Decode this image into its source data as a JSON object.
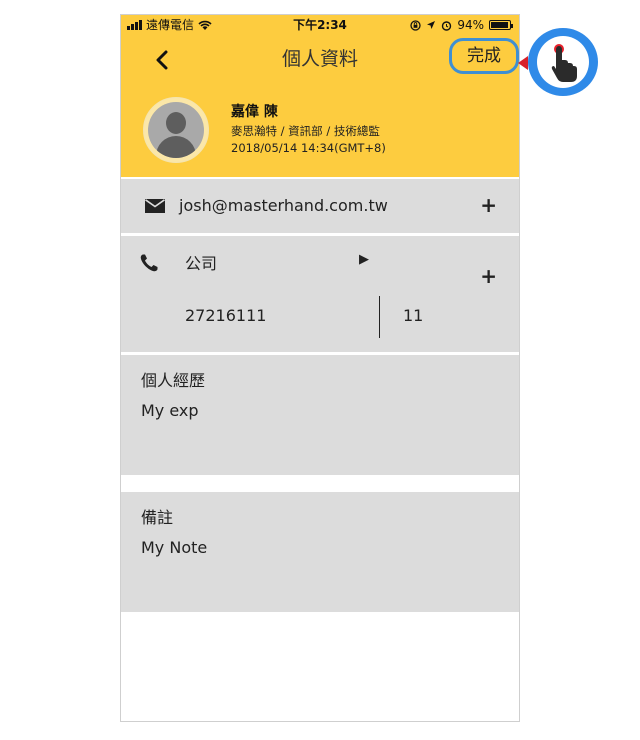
{
  "status_bar": {
    "carrier": "遠傳電信",
    "time": "下午2:34",
    "battery": "94%",
    "battery_level": 0.94
  },
  "nav": {
    "title": "個人資料",
    "done_label": "完成"
  },
  "profile": {
    "name": "嘉偉 陳",
    "title": "麥思瀚特 / 資訊部 / 技術總監",
    "timestamp": "2018/05/14 14:34(GMT+8)"
  },
  "email": {
    "value": "josh@masterhand.com.tw",
    "add": "+"
  },
  "phone": {
    "type": "公司",
    "dropdown": "▶",
    "add": "+",
    "number": "27216111",
    "ext": "11"
  },
  "experience": {
    "label": "個人經歷",
    "value": "My exp"
  },
  "note": {
    "label": "備註",
    "value": "My Note"
  },
  "colors": {
    "header": "#fdcc3f",
    "section_bg": "#dcdcdc",
    "highlight": "#3f8fd2",
    "pointer": "#d8202a"
  },
  "icons": [
    "signal-icon",
    "wifi-icon",
    "lock-rotation-icon",
    "location-icon",
    "alarm-icon",
    "battery-icon",
    "back-icon",
    "mail-icon",
    "phone-icon",
    "tap-hand-icon"
  ]
}
